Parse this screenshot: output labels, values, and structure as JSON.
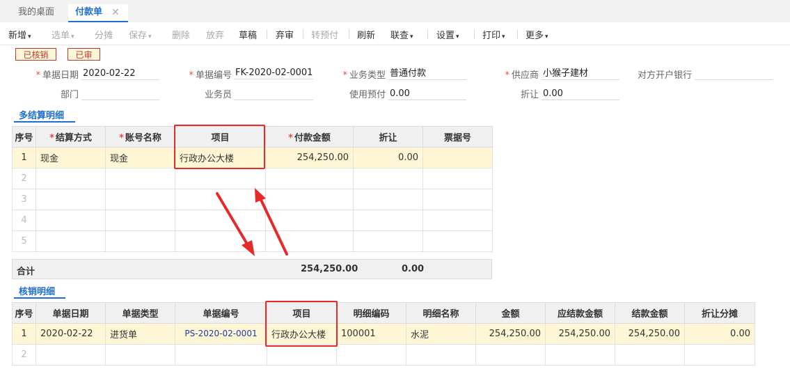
{
  "tabs": {
    "desk": "我的桌面",
    "active": "付款单",
    "close": "✕"
  },
  "toolbar": {
    "add": "新增",
    "select": "选单",
    "split": "分摊",
    "save": "保存",
    "delete": "删除",
    "abandon": "放弃",
    "draft": "草稿",
    "unaudit": "弃审",
    "to_prepay": "转预付",
    "refresh": "刷新",
    "link_query": "联查",
    "settings": "设置",
    "print": "打印",
    "more": "更多",
    "caret": "▾"
  },
  "stamps": {
    "verified": "已核销",
    "audited": "已审"
  },
  "form": {
    "date_label": "单据日期",
    "date_value": "2020-02-22",
    "no_label": "单据编号",
    "no_value": "FK-2020-02-0001",
    "biztype_label": "业务类型",
    "biztype_value": "普通付款",
    "supplier_label": "供应商",
    "supplier_value": "小猴子建材",
    "bank_label": "对方开户银行",
    "bank_value": "",
    "dept_label": "部门",
    "dept_value": "",
    "staff_label": "业务员",
    "staff_value": "",
    "prepay_label": "使用预付",
    "prepay_value": "0.00",
    "discount_label": "折让",
    "discount_value": "0.00",
    "req": "*"
  },
  "settle": {
    "title": "多结算明细",
    "headers": [
      "序号",
      "结算方式",
      "账号名称",
      "项目",
      "付款金额",
      "折让",
      "票据号"
    ],
    "row1": {
      "idx": "1",
      "method": "现金",
      "account": "现金",
      "project": "行政办公大楼",
      "amount": "254,250.00",
      "discount": "0.00",
      "bill": ""
    },
    "empty_idx": [
      "2",
      "3",
      "4",
      "5"
    ],
    "total_label": "合计",
    "total_amount": "254,250.00",
    "total_discount": "0.00"
  },
  "verify": {
    "title": "核销明细",
    "headers": [
      "序号",
      "单据日期",
      "单据类型",
      "单据编号",
      "项目",
      "明细编码",
      "明细名称",
      "金额",
      "应结款金额",
      "结款金额",
      "折让分摊"
    ],
    "row1": {
      "idx": "1",
      "date": "2020-02-22",
      "type": "进货单",
      "no": "PS-2020-02-0001",
      "project": "行政办公大楼",
      "code": "100001",
      "name": "水泥",
      "amount": "254,250.00",
      "due": "254,250.00",
      "paid": "254,250.00",
      "share": "0.00"
    },
    "empty_idx": [
      "2"
    ]
  },
  "colors": {
    "accent": "#1e6fcf",
    "highlight": "#e52a2a",
    "selected_row": "#fff6d5"
  }
}
